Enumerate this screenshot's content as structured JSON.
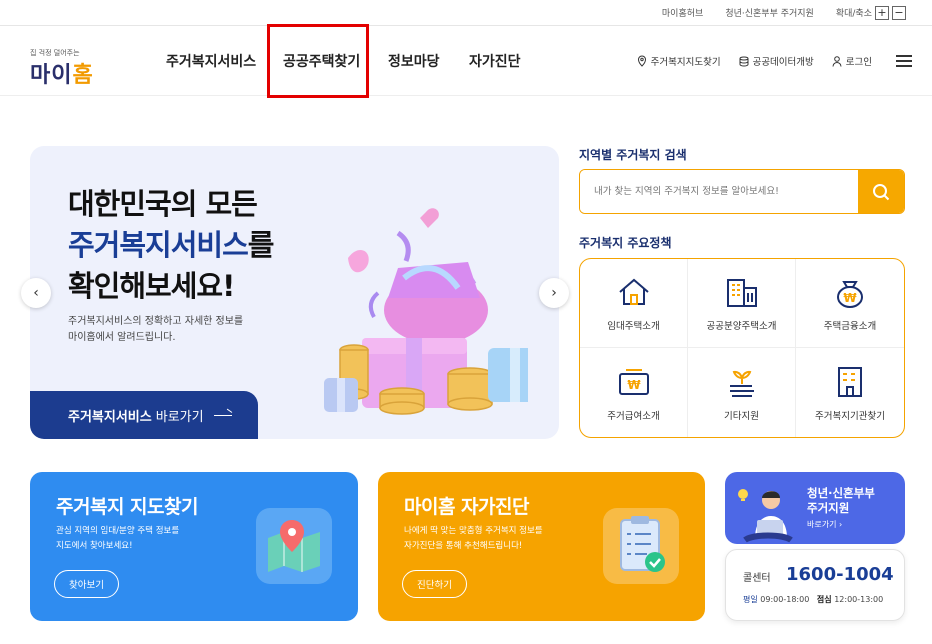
{
  "topbar": {
    "links": [
      "마이홈허브",
      "청년·신혼부부 주거지원"
    ],
    "zoom_label": "확대/축소",
    "zoom_in": "+",
    "zoom_out": "−"
  },
  "logo": {
    "tagline": "집 걱정 덜어주는",
    "text_a": "마이",
    "text_b": "홈"
  },
  "nav": [
    "주거복지서비스",
    "공공주택찾기",
    "정보마당",
    "자가진단"
  ],
  "util": {
    "map": "주거복지지도찾기",
    "data": "공공데이터개방",
    "login": "로그인"
  },
  "hero": {
    "line1": "대한민국의 모든",
    "line2_em": "주거복지서비스",
    "line2_rest": "를",
    "line3": "확인해보세요!",
    "desc1": "주거복지서비스의 정확하고 자세한 정보를",
    "desc2": "마이홈에서 알려드립니다.",
    "cta_bold": "주거복지서비스",
    "cta_rest": "바로가기",
    "prev": "‹",
    "next": "›"
  },
  "search": {
    "title": "지역별 주거복지 검색",
    "placeholder": "내가 찾는 지역의 주거복지 정보를 알아보세요!"
  },
  "policy": {
    "title": "주거복지 주요정책",
    "items": [
      {
        "label": "임대주택소개",
        "icon": "house-icon"
      },
      {
        "label": "공공분양주택소개",
        "icon": "apartment-icon"
      },
      {
        "label": "주택금융소개",
        "icon": "money-bag-icon"
      },
      {
        "label": "주거급여소개",
        "icon": "won-card-icon"
      },
      {
        "label": "기타지원",
        "icon": "sprout-icon"
      },
      {
        "label": "주거복지기관찾기",
        "icon": "building-icon"
      }
    ]
  },
  "cards": {
    "map": {
      "title": "주거복지 지도찾기",
      "desc1": "관심 지역의 임대/분양 주택 정보를",
      "desc2": "지도에서 찾아보세요!",
      "button": "찾아보기",
      "color": "#2f8cf0"
    },
    "diag": {
      "title": "마이홈 자가진단",
      "desc1": "나에게 딱 맞는 맞춤형 주거복지 정보를",
      "desc2": "자가진단을 통해 추천해드립니다!",
      "button": "진단하기",
      "color": "#f6a300"
    }
  },
  "youth": {
    "title1": "청년·신혼부부",
    "title2": "주거지원",
    "go": "바로가기 ›"
  },
  "callcenter": {
    "label": "콜센터",
    "number": "1600-1004",
    "weekday_label": "평일",
    "weekday_hours": "09:00-18:00",
    "lunch_label": "점심",
    "lunch_hours": "12:00-13:00"
  }
}
